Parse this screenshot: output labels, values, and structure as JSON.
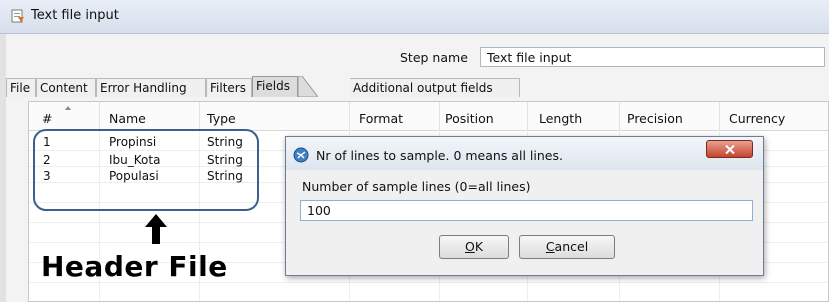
{
  "window": {
    "title": "Text file input",
    "app_icon": "text-file-input-icon"
  },
  "step": {
    "label": "Step name",
    "value": "Text file input"
  },
  "tabs": [
    {
      "label": "File",
      "active": false
    },
    {
      "label": "Content",
      "active": false
    },
    {
      "label": "Error Handling",
      "active": false
    },
    {
      "label": "Filters",
      "active": false
    },
    {
      "label": "Fields",
      "active": true
    },
    {
      "label": "Additional output fields",
      "active": false
    }
  ],
  "table": {
    "columns": [
      "#",
      "Name",
      "Type",
      "Format",
      "Position",
      "Length",
      "Precision",
      "Currency"
    ],
    "rows": [
      {
        "num": "1",
        "name": "Propinsi",
        "type": "String"
      },
      {
        "num": "2",
        "name": "Ibu_Kota",
        "type": "String"
      },
      {
        "num": "3",
        "name": "Populasi",
        "type": "String"
      }
    ]
  },
  "annotation": {
    "text": "Header File",
    "arrow": "up-arrow-icon"
  },
  "dialog": {
    "title": "Nr of lines to sample.  0 means all lines.",
    "icon": "spoon-icon",
    "label": "Number of sample lines (0=all lines)",
    "value": "100",
    "ok_label": "OK",
    "cancel_label": "Cancel"
  },
  "colors": {
    "highlight": "#3c5f8e",
    "close_button": "#c5442e"
  }
}
